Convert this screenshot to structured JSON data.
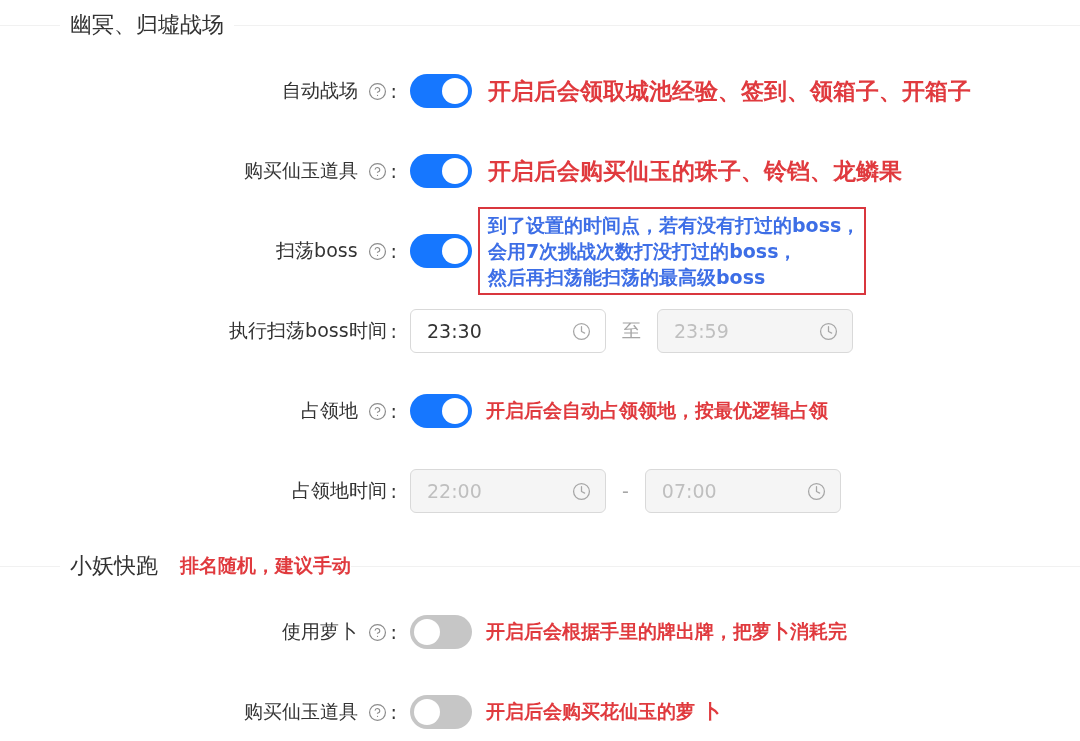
{
  "sections": [
    {
      "title": "幽冥、归墟战场",
      "fields": [
        {
          "kind": "switch",
          "label": "自动战场",
          "help": true,
          "colon": ":",
          "on": true,
          "note": {
            "kind": "large",
            "text": "开启后会领取城池经验、签到、领箱子、开箱子"
          }
        },
        {
          "kind": "switch",
          "label": "购买仙玉道具",
          "help": true,
          "colon": ":",
          "on": true,
          "note": {
            "kind": "large",
            "text": "开启后会购买仙玉的珠子、铃铛、龙鳞果"
          }
        },
        {
          "kind": "switch",
          "label": "扫荡boss",
          "help": true,
          "colon": ":",
          "on": true,
          "note": {
            "kind": "boxed",
            "lines": [
              "到了设置的时间点，若有没有打过的boss，",
              "会用7次挑战次数打没打过的boss，",
              "然后再扫荡能扫荡的最高级boss"
            ]
          }
        },
        {
          "kind": "time_range",
          "label": "执行扫荡boss时间",
          "colon": ":",
          "start": {
            "value": "23:30",
            "disabled": false
          },
          "separator": "至",
          "end": {
            "value": "23:59",
            "disabled": true
          }
        },
        {
          "kind": "switch",
          "label": "占领地",
          "help": true,
          "colon": ":",
          "on": true,
          "note": {
            "kind": "small",
            "text": "开启后会自动占领领地，按最优逻辑占领"
          }
        },
        {
          "kind": "time_range",
          "label": "占领地时间",
          "colon": ":",
          "start": {
            "value": "22:00",
            "disabled": true
          },
          "separator": "-",
          "end": {
            "value": "07:00",
            "disabled": true
          }
        }
      ]
    },
    {
      "title": "小妖快跑",
      "note": {
        "kind": "small",
        "text": "排名随机，建议手动"
      },
      "fields": [
        {
          "kind": "switch",
          "label": "使用萝卜",
          "help": true,
          "colon": ":",
          "on": false,
          "note": {
            "kind": "small",
            "text": "开启后会根据手里的牌出牌，把萝卜消耗完"
          }
        },
        {
          "kind": "switch",
          "label": "购买仙玉道具",
          "help": true,
          "colon": ":",
          "on": false,
          "note": {
            "kind": "small",
            "text": "开启后会购买花仙玉的萝 卜"
          }
        }
      ]
    }
  ]
}
